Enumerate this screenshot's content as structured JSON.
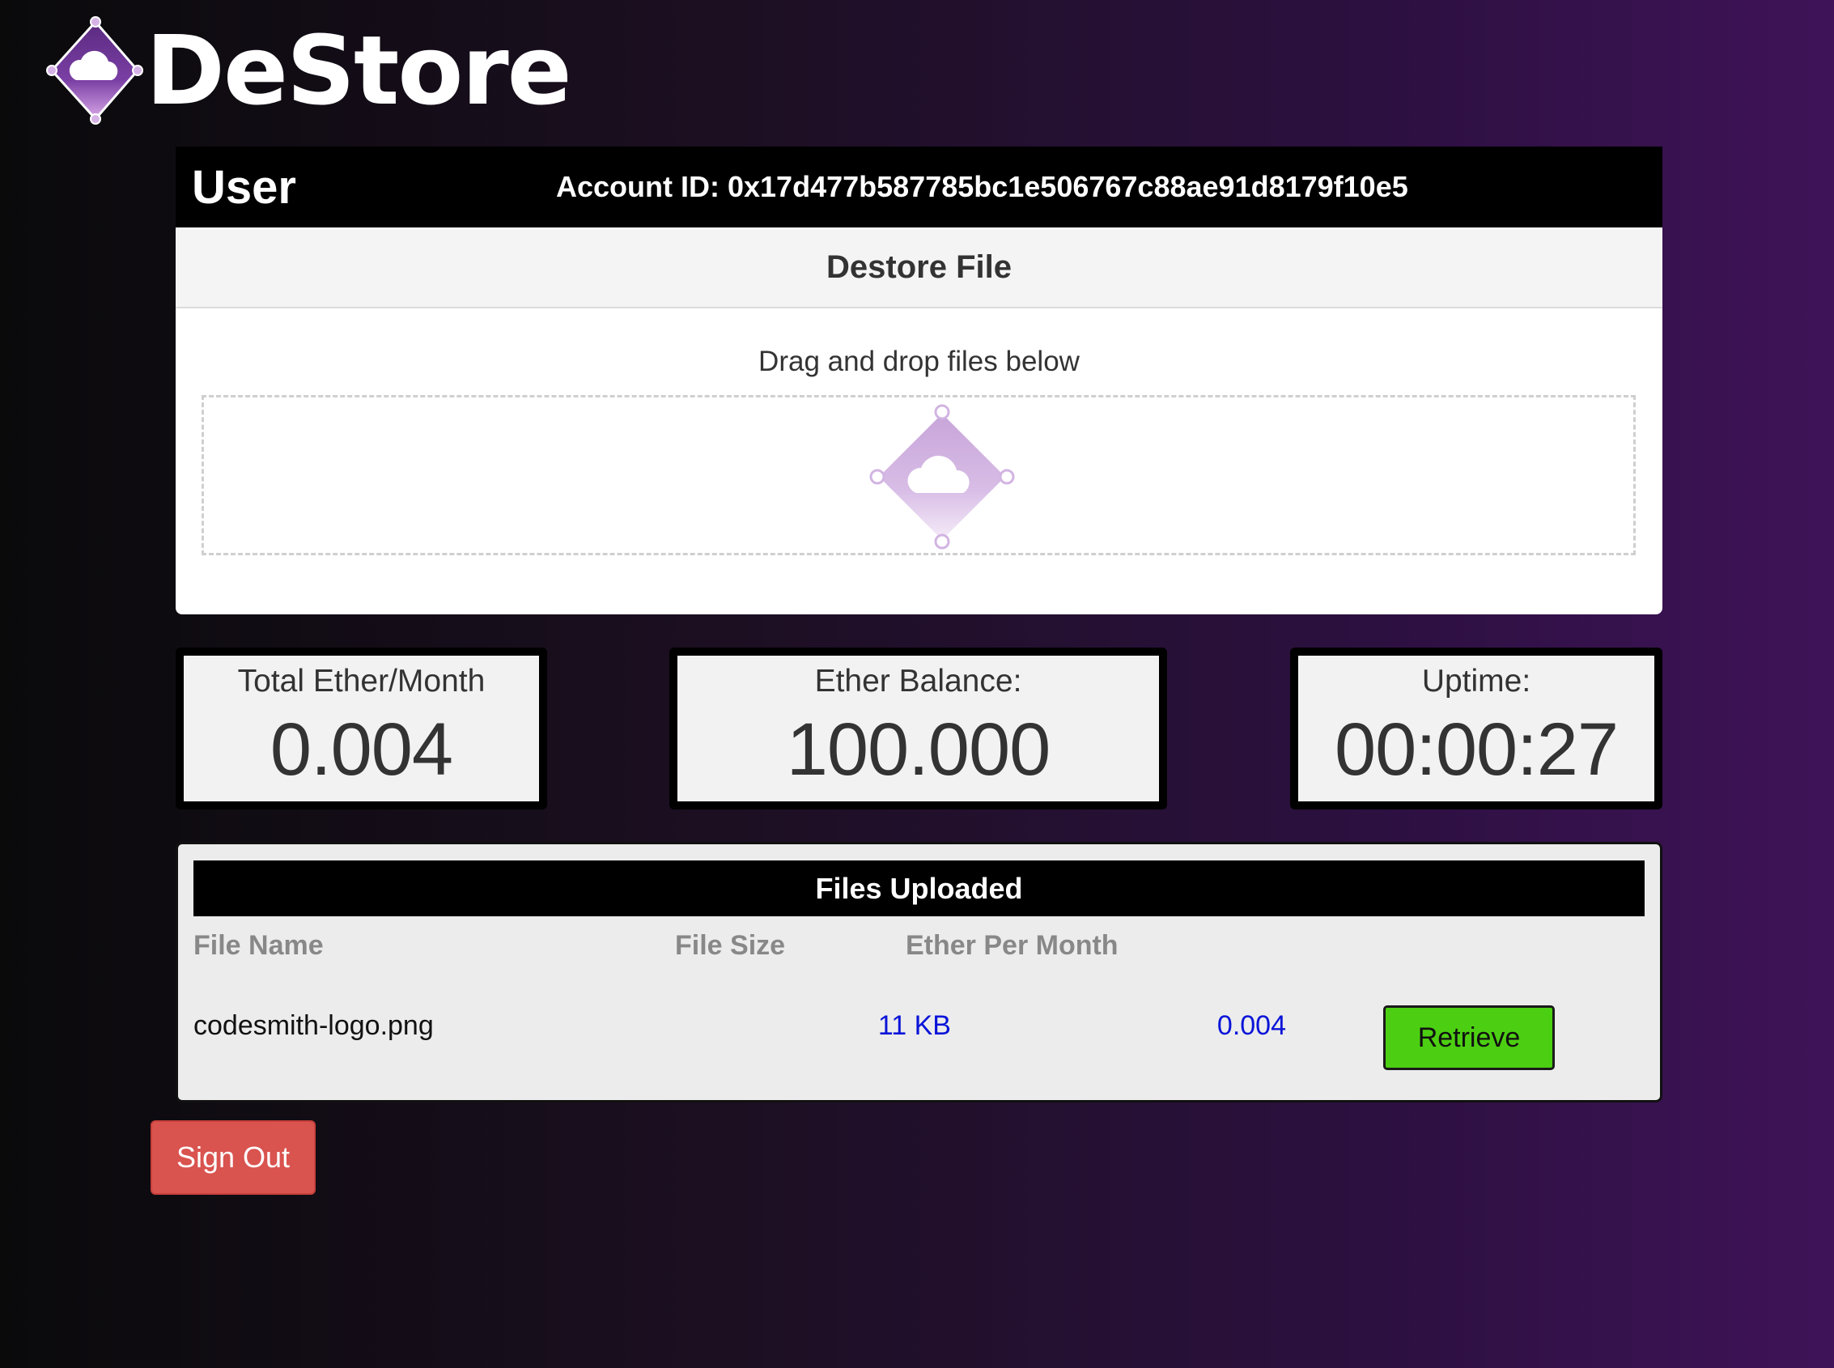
{
  "brand": {
    "name": "DeStore",
    "logo_icon": "cloud-diamond-icon"
  },
  "user_bar": {
    "title": "User",
    "account_id": "Account ID: 0x17d477b587785bc1e506767c88ae91d8179f10e5"
  },
  "upload": {
    "title": "Destore File",
    "hint": "Drag and drop files below",
    "drop_icon": "cloud-diamond-icon"
  },
  "stats": [
    {
      "label": "Total Ether/Month",
      "value": "0.004"
    },
    {
      "label": "Ether Balance:",
      "value": "100.000"
    },
    {
      "label": "Uptime:",
      "value": "00:00:27"
    }
  ],
  "files": {
    "title": "Files Uploaded",
    "columns": [
      "File Name",
      "File Size",
      "Ether Per Month"
    ],
    "rows": [
      {
        "name": "codesmith-logo.png",
        "size": "11 KB",
        "ether": "0.004",
        "action": "Retrieve"
      }
    ]
  },
  "sign_out": "Sign Out",
  "colors": {
    "accent_purple": "#6a3b8f",
    "retrieve_green": "#4ccf12",
    "sign_out_red": "#d9534f",
    "value_blue": "#0a14d8"
  }
}
